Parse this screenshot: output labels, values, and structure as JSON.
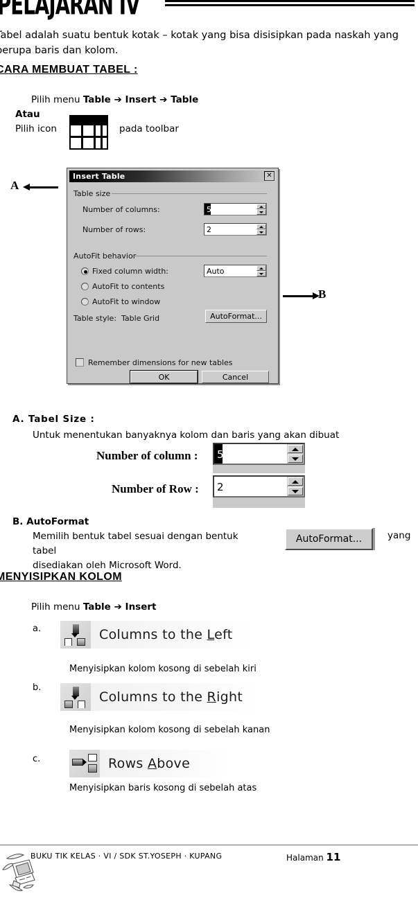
{
  "document": {
    "lesson_title": "PELAJARAN IV",
    "intro_text": "Tabel adalah suatu bentuk kotak – kotak yang bisa disisipkan pada naskah  yang berupa baris dan kolom.",
    "heading_cara": "CARA MEMBUAT TABEL :",
    "heading_menyisipkan": "MENYISIPKAN KOLOM"
  },
  "steps": {
    "pilih_menu_1_prefix": "Pilih menu ",
    "pilih_menu_1_bold": "Table  ➔  Insert  ➔  Table",
    "atau": "Atau",
    "pilih_icon": "Pilih icon",
    "pada_toolbar": "pada toolbar",
    "pilih_menu_2_prefix": "Pilih menu ",
    "pilih_menu_2_bold": "Table  ➔  Insert"
  },
  "markers": {
    "a": "A",
    "b": "B"
  },
  "dialog": {
    "title": "Insert Table",
    "close_label": "✕",
    "group_table_size": "Table size",
    "label_columns": "Number of columns:",
    "label_columns_mnemonic": "c",
    "value_columns": "5",
    "label_rows": "Number of rows:",
    "label_rows_mnemonic": "r",
    "value_rows": "2",
    "group_autofit": "AutoFit behavior",
    "radio_fixed": "Fixed column width:",
    "radio_fixed_selected": true,
    "value_fixed_width": "Auto",
    "radio_contents": "AutoFit to contents",
    "radio_window": "AutoFit to window",
    "table_style_label": "Table style:",
    "table_style_value": "Table Grid",
    "autoformat_button": "AutoFormat...",
    "remember_checkbox": "Remember dimensions for new tables",
    "ok_button": "OK",
    "cancel_button": "Cancel"
  },
  "section_a": {
    "heading": "A.  Tabel Size  :",
    "body": "Untuk menentukan banyaknya kolom dan baris yang akan dibuat",
    "label_column": "Number of column :",
    "value_column": "5",
    "label_row": "Number of Row :",
    "value_row": "2"
  },
  "section_b": {
    "heading": "B.  AutoFormat",
    "body_line1": "Memilih bentuk tabel sesuai dengan bentuk tabel",
    "body_line2": "disediakan oleh Microsoft Word.",
    "button": "AutoFormat...",
    "trailing_word": "yang"
  },
  "insert_menu": [
    {
      "letter": "a.",
      "label_pre": "Columns to the ",
      "label_mnemonic": "L",
      "label_post": "eft",
      "icon": "columns-left-icon",
      "description": "Menyisipkan kolom kosong di sebelah kiri"
    },
    {
      "letter": "b.",
      "label_pre": "Columns to the ",
      "label_mnemonic": "R",
      "label_post": "ight",
      "icon": "columns-right-icon",
      "description": "Menyisipkan kolom kosong di sebelah kanan"
    },
    {
      "letter": "c.",
      "label_pre": "Rows ",
      "label_mnemonic": "A",
      "label_post": "bove",
      "icon": "rows-above-icon",
      "description": "Menyisipkan baris kosong di sebelah atas"
    }
  ],
  "footer": {
    "book_line": "BUKU TIK KELAS   ·  VI / SDK ST.YOSEPH · KUPANG",
    "page_label": "Halaman",
    "page_number": "11"
  },
  "colors": {
    "dialog_face": "#c9c9c9",
    "titlebar_start": "#000000",
    "titlebar_end": "#cfcfcf",
    "ink": "#000000",
    "paper": "#ffffff"
  }
}
